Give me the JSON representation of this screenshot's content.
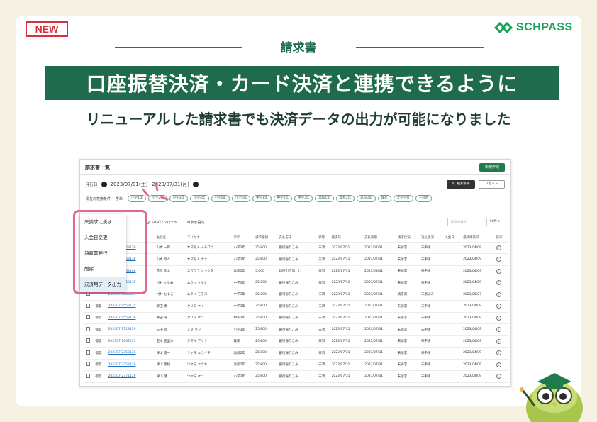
{
  "badge": "NEW",
  "brand": {
    "name": "SCHPASS",
    "color": "#17a25a"
  },
  "section_title": "請求書",
  "headline": "口座振替決済・カード決済と連携できるように",
  "subhead": "リニューアルした請求書でも決済データの出力が可能になりました",
  "colors": {
    "primary": "#1f6b4e",
    "accent_pink": "#e0679b",
    "link": "#1b6fc2"
  },
  "screen": {
    "title": "請求書一覧",
    "new_button": "新規作成",
    "date_label": "発行日",
    "date_range": "2023/07/01(土)~2023/07/31(月)",
    "search_button": "検索条件",
    "reset_button": "リセット",
    "condition_label": "現在の検索条件",
    "grade_label": "学年",
    "chips": [
      "小学1年",
      "小学2年",
      "小学3年",
      "小学4年",
      "小学5年",
      "小学6年",
      "中学1年",
      "中学2年",
      "中学3年",
      "高校1年",
      "高校2年",
      "高校3年",
      "既卒",
      "大学学習",
      "その他"
    ],
    "csv_download": "CSVダウンロード",
    "display_settings": "表示設定",
    "search_placeholder": "ID/請求番号",
    "per_page": "50件",
    "columns": [
      "",
      "",
      "請求書番号",
      "生徒名",
      "フリガナ",
      "学年",
      "請求金額",
      "支払方法",
      "状態",
      "請求日",
      "支払期限",
      "請求状況",
      "消込状況",
      "入金日",
      "最終更新日",
      "操作"
    ],
    "rows": [
      [
        "",
        "",
        "202307-1158139",
        "山本 一郎",
        "ヤマモト イチロウ",
        "小学3年",
        "25,800",
        "銀行振りこみ",
        "未済",
        "2023/07/31",
        "2023/07/31",
        "未請求",
        "未申請",
        "",
        "2023/04/09"
      ],
      [
        "",
        "",
        "202307-1158138",
        "山本 奈々",
        "ヤマモト ナナ",
        "小学3年",
        "25,800",
        "銀行振りこみ",
        "未済",
        "2023/07/31",
        "2023/07/31",
        "未請求",
        "未申請",
        "",
        "2023/04/09"
      ],
      [
        "",
        "",
        "202307-1468108",
        "菅原 翔太",
        "スガワラ ショウタ",
        "高校1年",
        "5,000",
        "口座引き落とし",
        "未済",
        "2023/07/31",
        "2023/08/31",
        "未請求",
        "未申請",
        "",
        "2023/04/09"
      ],
      [
        "",
        "",
        "202307-1468135",
        "村井 くるみ",
        "ムライ クルミ",
        "中学3年",
        "25,800",
        "銀行振りこみ",
        "未済",
        "2023/07/31",
        "2023/07/31",
        "未請求",
        "未申請",
        "",
        "2023/04/09"
      ],
      [
        "",
        "",
        "202307-1588881",
        "村井 ももこ",
        "ムライ モモコ",
        "中学3年",
        "25,800",
        "銀行振りこみ",
        "未済",
        "2023/07/31",
        "2023/07/31",
        "請求済",
        "未消込み",
        "",
        "2023/05/27"
      ],
      [
        "",
        "都度",
        "202307-1553135",
        "栗田 恵",
        "クリタ ケイ",
        "中学3年",
        "25,800",
        "銀行振りこみ",
        "未済",
        "2023/07/31",
        "2023/07/31",
        "未請求",
        "未申請",
        "",
        "2023/04/09"
      ],
      [
        "",
        "都度",
        "202307-1558138",
        "栗田 研",
        "クリタ ケン",
        "中学3年",
        "25,800",
        "銀行振りこみ",
        "未済",
        "2023/07/31",
        "2023/07/31",
        "未請求",
        "未申請",
        "",
        "2023/04/09"
      ],
      [
        "",
        "都度",
        "202307-1713139",
        "三田 凛",
        "ミタ リン",
        "小学3年",
        "25,800",
        "銀行振りこみ",
        "未済",
        "2023/07/31",
        "2023/07/31",
        "未請求",
        "未申請",
        "",
        "2023/04/09"
      ],
      [
        "",
        "都度",
        "202307-1667135",
        "玉木 亜里沙",
        "タマキ アリサ",
        "既卒",
        "25,800",
        "銀行振りこみ",
        "未済",
        "2023/07/31",
        "2023/07/31",
        "未請求",
        "未申請",
        "",
        "2023/04/09"
      ],
      [
        "",
        "都度",
        "202307-2358138",
        "津山 勇一",
        "ツヤマ ユウイチ",
        "高校2年",
        "25,800",
        "銀行振りこみ",
        "未済",
        "2023/07/31",
        "2023/07/31",
        "未請求",
        "未申請",
        "",
        "2023/04/09"
      ],
      [
        "",
        "都度",
        "202307-2358139",
        "津山 悠紀",
        "ツヤマ ユウキ",
        "高校2年",
        "25,800",
        "銀行振りこみ",
        "未済",
        "2023/07/31",
        "2023/07/31",
        "未請求",
        "未申請",
        "",
        "2023/04/09"
      ],
      [
        "",
        "都度",
        "202307-2371139",
        "津山 健",
        "ツヤマ ケン",
        "小学3年",
        "25,800",
        "銀行振りこみ",
        "未済",
        "2023/07/31",
        "2023/07/31",
        "未請求",
        "未申請",
        "",
        "2023/04/09"
      ]
    ],
    "dropdown": [
      "未請求に戻す",
      "入金日変更",
      "領収書発行",
      "削除",
      "決済用データ出力"
    ]
  }
}
